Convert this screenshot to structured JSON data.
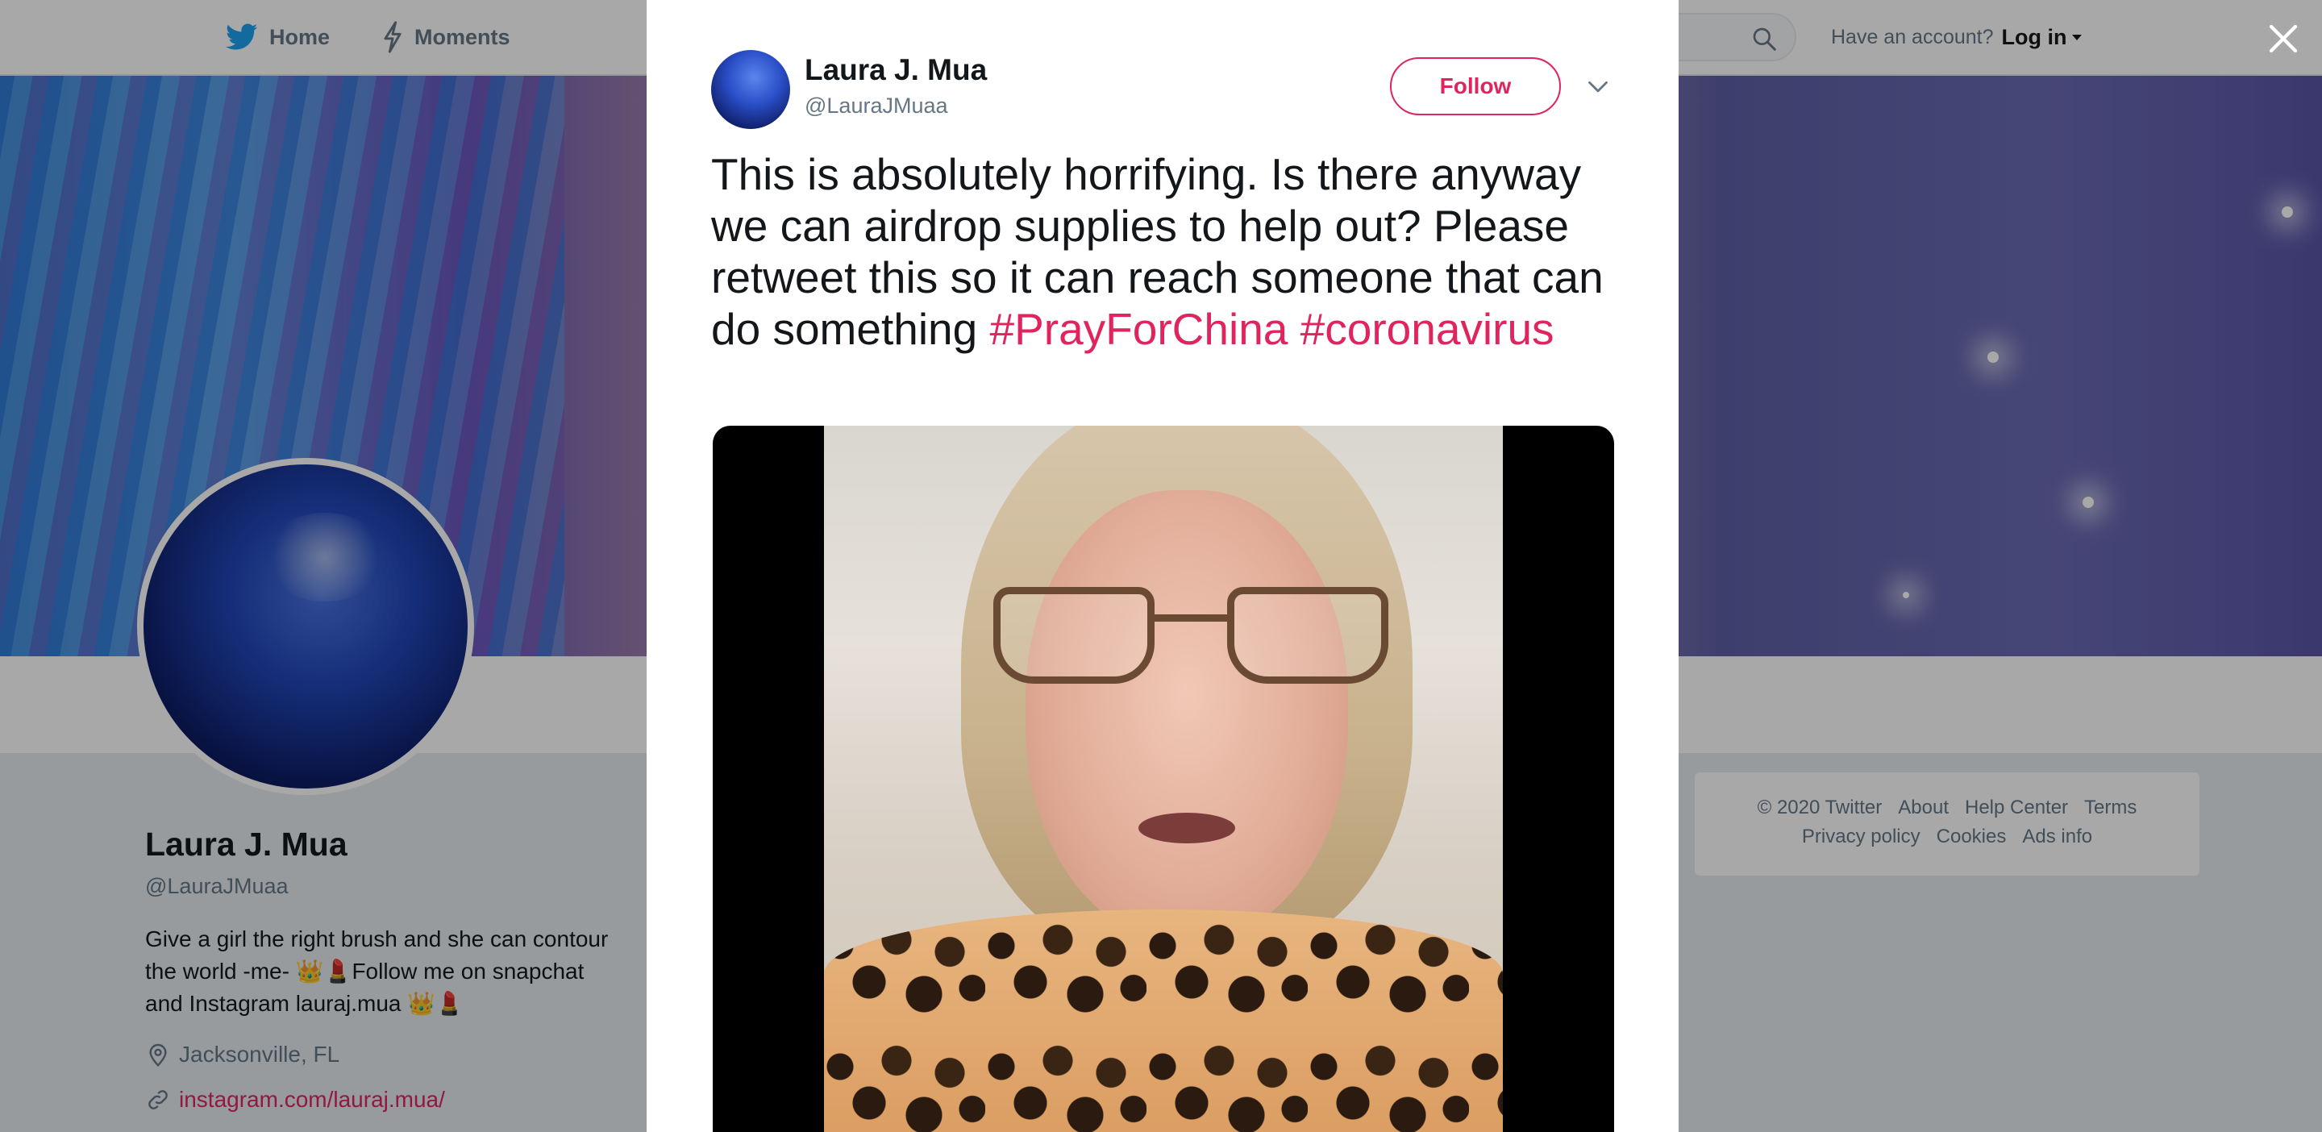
{
  "nav": {
    "home_label": "Home",
    "moments_label": "Moments",
    "account_prompt": "Have an account?",
    "login_label": "Log in"
  },
  "profile": {
    "name": "Laura J. Mua",
    "handle": "@LauraJMuaa",
    "bio": "Give a girl the right brush and she can contour the world -me- 👑💄Follow me on snapchat and Instagram lauraj.mua 👑💄",
    "location": "Jacksonville, FL",
    "website": "instagram.com/lauraj.mua/"
  },
  "footer": {
    "copyright": "© 2020 Twitter",
    "about": "About",
    "help_center": "Help Center",
    "terms": "Terms",
    "privacy": "Privacy policy",
    "cookies": "Cookies",
    "ads_info": "Ads info"
  },
  "tweet": {
    "author_name": "Laura J. Mua",
    "author_handle": "@LauraJMuaa",
    "follow_label": "Follow",
    "text": "This is absolutely horrifying. Is there anyway we can airdrop supplies to help out? Please retweet this so it can reach someone that can do something",
    "hashtags": [
      "#PrayForChina",
      "#coronavirus"
    ]
  },
  "colors": {
    "accent": "#e0245e",
    "twitter_blue": "#1da1f2",
    "secondary_text": "#657786"
  },
  "icons": {
    "home": "twitter-bird-icon",
    "moments": "lightning-icon",
    "search": "search-icon",
    "close": "close-icon",
    "location": "location-pin-icon",
    "link": "link-icon",
    "more": "chevron-down-icon"
  }
}
